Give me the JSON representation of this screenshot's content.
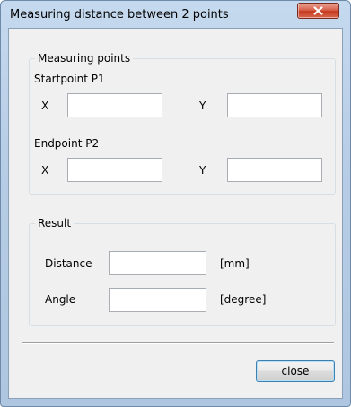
{
  "window": {
    "title": "Measuring distance between 2 points",
    "close_icon": "close-x-icon"
  },
  "measuring_points": {
    "group_title": "Measuring points",
    "startpoint": {
      "label": "Startpoint P1",
      "x_label": "X",
      "y_label": "Y",
      "x_value": "",
      "y_value": ""
    },
    "endpoint": {
      "label": "Endpoint P2",
      "x_label": "X",
      "y_label": "Y",
      "x_value": "",
      "y_value": ""
    }
  },
  "result": {
    "group_title": "Result",
    "distance_label": "Distance",
    "distance_value": "",
    "distance_unit": "[mm]",
    "angle_label": "Angle",
    "angle_value": "",
    "angle_unit": "[degree]"
  },
  "buttons": {
    "close_label": "close"
  },
  "colors": {
    "close_button_red": "#c43a1f",
    "focus_border": "#3c7fb1"
  }
}
